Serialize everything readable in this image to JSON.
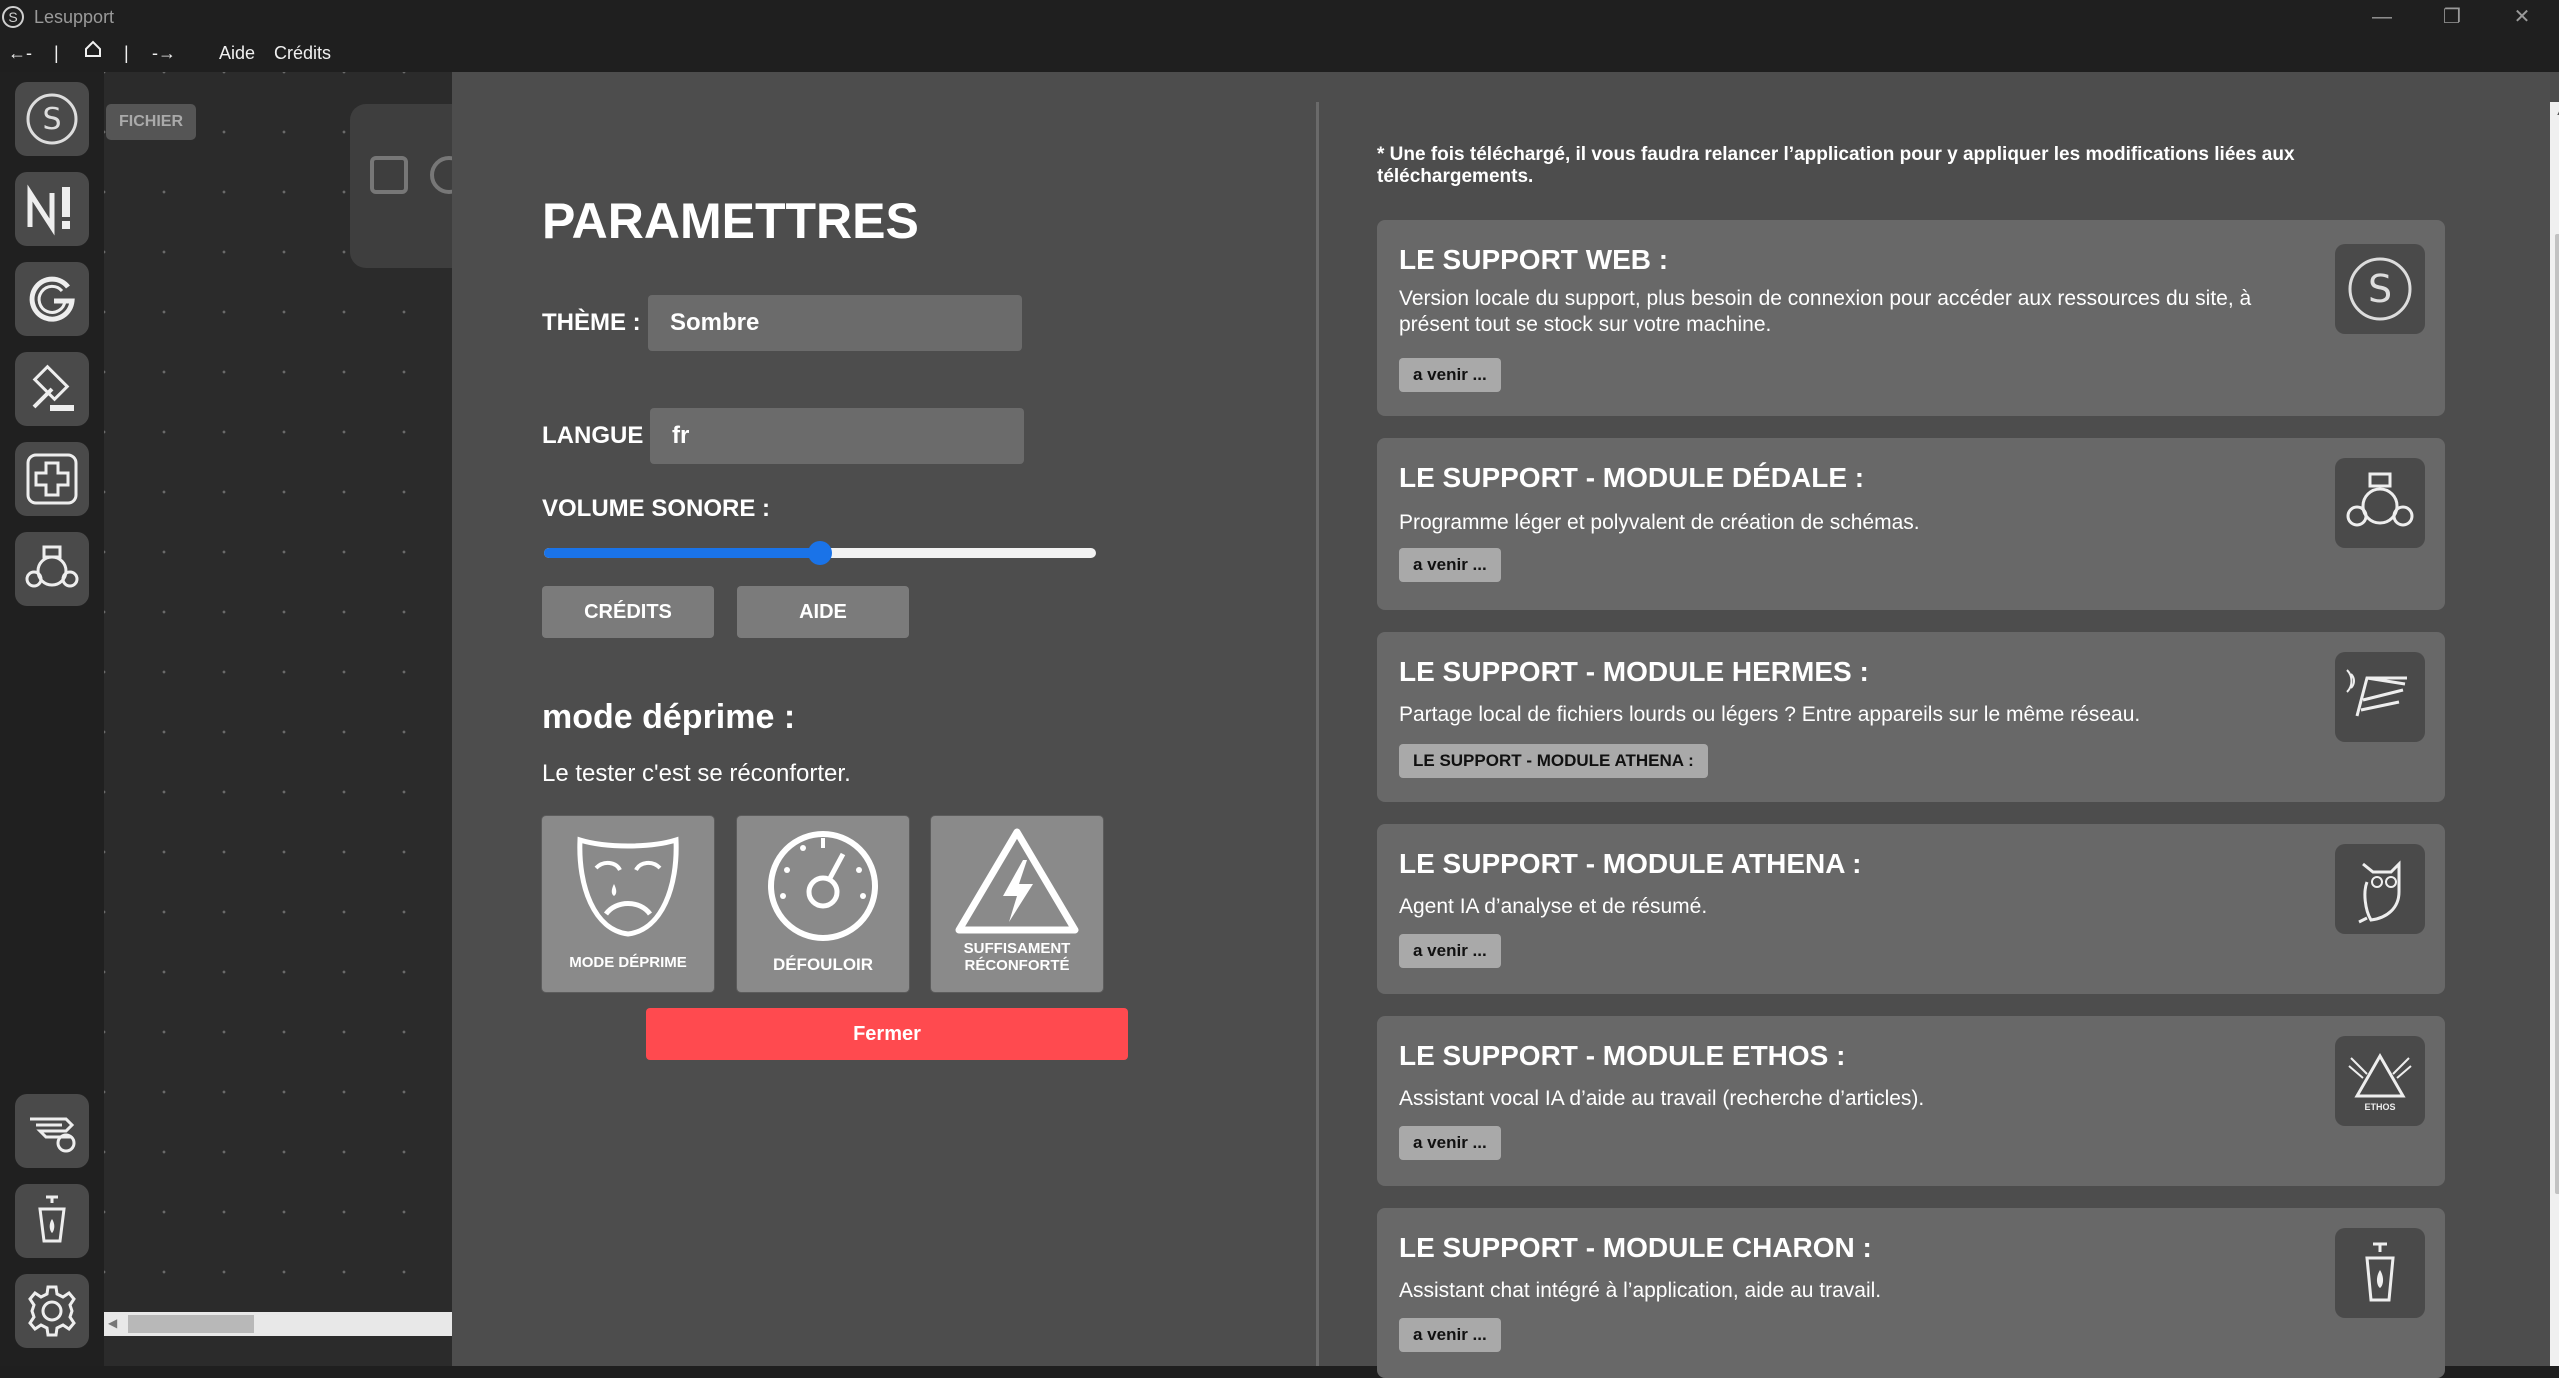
{
  "window": {
    "title": "Lesupport",
    "app_icon": "S",
    "controls": [
      "minimize-icon",
      "restore-icon",
      "close-icon"
    ]
  },
  "menubar": {
    "back": "←-",
    "sep1": "|",
    "home_icon": "home-icon",
    "sep2": "|",
    "forward": "-→",
    "aide": "Aide",
    "credits": "Crédits"
  },
  "rail": {
    "items": [
      "lesupport-icon",
      "alert-icon",
      "g-icon",
      "gavel-icon",
      "plus-icon",
      "dedale-icon"
    ],
    "bottom_items": [
      "hermes-icon",
      "charon-lantern-icon",
      "gear-icon"
    ]
  },
  "canvas": {
    "file_tag": "FICHIER"
  },
  "settings": {
    "title": "PARAMETTRES",
    "theme_label": "THÈME :",
    "theme_value": "Sombre",
    "lang_label": "LANGUE",
    "lang_value": "fr",
    "volume_label": "VOLUME SONORE :",
    "volume_percent": 50,
    "credits_button": "CRÉDITS",
    "aide_button": "AIDE",
    "mode_title": "mode déprime :",
    "mode_subtitle": "Le tester c'est se réconforter.",
    "mode_cards": {
      "deprime": "MODE DÉPRIME",
      "defouloir": "DÉFOULOIR",
      "reconforte_1": "SUFFISAMENT",
      "reconforte_2": "RÉCONFORTÉ"
    },
    "close_button": "Fermer",
    "accent_color": "#1a73e8",
    "close_color": "#ff4a4f"
  },
  "modules": {
    "notice": "* Une fois téléchargé, il vous faudra relancer l’application pour y appliquer les modifications liées aux téléchargements.",
    "items": [
      {
        "title": "LE SUPPORT WEB :",
        "description": "Version locale du support, plus besoin de connexion pour accéder aux ressources du site, à présent tout se stock sur votre machine.",
        "badge": "a venir ...",
        "icon": "lesupport-icon"
      },
      {
        "title": "LE SUPPORT - MODULE DÉDALE :",
        "description": "Programme léger et polyvalent de création de schémas.",
        "badge": "a venir ...",
        "icon": "dedale-icon"
      },
      {
        "title": "LE SUPPORT - MODULE HERMES :",
        "description": "Partage local de fichiers lourds ou légers ? Entre appareils sur le même réseau.",
        "badge": "LE SUPPORT - MODULE ATHENA :",
        "icon": "hermes-wing-icon"
      },
      {
        "title": "LE SUPPORT - MODULE ATHENA :",
        "description": "Agent IA d’analyse et de résumé.",
        "badge": "a venir ...",
        "icon": "owl-icon"
      },
      {
        "title": "LE SUPPORT - MODULE ETHOS :",
        "description": "Assistant vocal IA d’aide au travail (recherche d’articles).",
        "badge": "a venir ...",
        "icon": "ethos-icon",
        "icon_text": "ETHOS"
      },
      {
        "title": "LE SUPPORT - MODULE CHARON :",
        "description": "Assistant chat intégré à l’application, aide au travail.",
        "badge": "a venir ...",
        "icon": "lantern-icon"
      }
    ]
  }
}
